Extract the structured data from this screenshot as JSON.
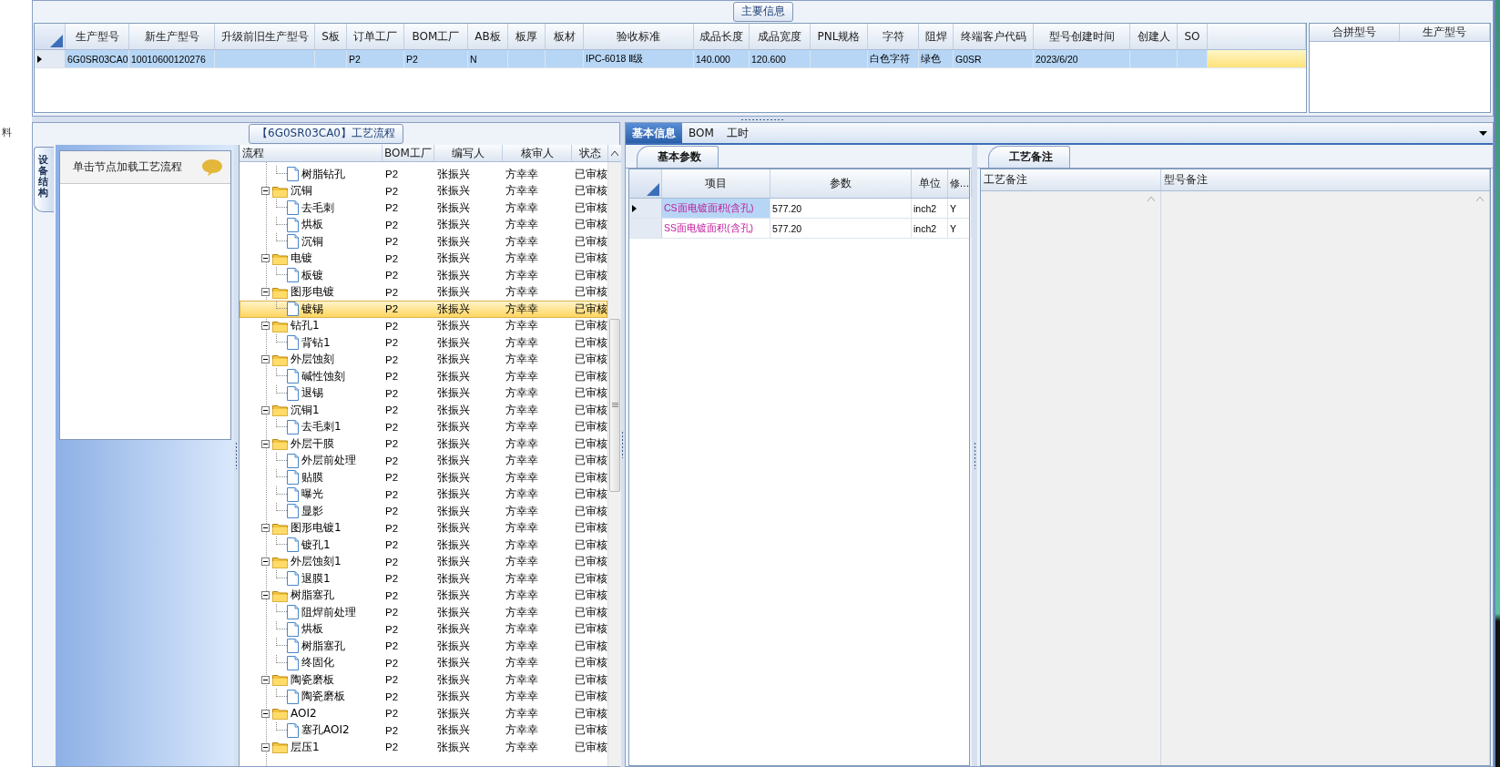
{
  "left_edge_text": "料",
  "main_info": {
    "title": "主要信息",
    "columns": [
      "生产型号",
      "新生产型号",
      "升级前旧生产型号",
      "S板",
      "订单工厂",
      "BOM工厂",
      "AB板",
      "板厚",
      "板材",
      "验收标准",
      "成品长度",
      "成品宽度",
      "PNL规格",
      "字符",
      "阻焊",
      "终端客户代码",
      "型号创建时间",
      "创建人",
      "SO"
    ],
    "rows": [
      {
        "selected": true,
        "cells": [
          "6G0SR03CA0",
          "10010600120276",
          null,
          null,
          "P2",
          "P2",
          "N",
          null,
          null,
          "IPC-6018 Ⅱ级",
          "140.000",
          "120.600",
          null,
          "白色字符",
          "绿色",
          "G0SR",
          "2023/6/20",
          null,
          null
        ]
      }
    ]
  },
  "merge_grid": {
    "columns": [
      "合拼型号",
      "生产型号"
    ]
  },
  "process_panel": {
    "title": "【6G0SR03CA0】工艺流程",
    "side_tabs": [
      {
        "label": "设备结构",
        "selected": true
      }
    ],
    "nav_hint": "单击节点加载工艺流程",
    "tree": {
      "columns": [
        "流程",
        "BOM工厂",
        "编写人",
        "核审人",
        "状态"
      ],
      "items": [
        {
          "kind": "continued",
          "children": [
            {
              "kind": "step",
              "label": "树脂钻孔",
              "bom": "P2",
              "writer": "张振兴",
              "reviewer": "方幸幸",
              "status": "已审核",
              "selected": false
            }
          ]
        },
        {
          "kind": "folder",
          "label": "沉铜",
          "bom": "P2",
          "writer": "张振兴",
          "reviewer": "方幸幸",
          "status": "已审核",
          "selected": false,
          "expanded": true,
          "children": [
            {
              "kind": "step",
              "label": "去毛刺",
              "bom": "P2",
              "writer": "张振兴",
              "reviewer": "方幸幸",
              "status": "已审核",
              "selected": false
            },
            {
              "kind": "step",
              "label": "烘板",
              "bom": "P2",
              "writer": "张振兴",
              "reviewer": "方幸幸",
              "status": "已审核",
              "selected": false
            },
            {
              "kind": "step",
              "label": "沉铜",
              "bom": "P2",
              "writer": "张振兴",
              "reviewer": "方幸幸",
              "status": "已审核",
              "selected": false
            }
          ]
        },
        {
          "kind": "folder",
          "label": "电镀",
          "bom": "P2",
          "writer": "张振兴",
          "reviewer": "方幸幸",
          "status": "已审核",
          "selected": false,
          "expanded": true,
          "children": [
            {
              "kind": "step",
              "label": "板镀",
              "bom": "P2",
              "writer": "张振兴",
              "reviewer": "方幸幸",
              "status": "已审核",
              "selected": false
            }
          ]
        },
        {
          "kind": "folder",
          "label": "图形电镀",
          "bom": "P2",
          "writer": "张振兴",
          "reviewer": "方幸幸",
          "status": "已审核",
          "selected": false,
          "expanded": true,
          "children": [
            {
              "kind": "step",
              "label": "镀锡",
              "bom": "P2",
              "writer": "张振兴",
              "reviewer": "方幸幸",
              "status": "已审核",
              "selected": true
            }
          ]
        },
        {
          "kind": "folder",
          "label": "钻孔1",
          "bom": "P2",
          "writer": "张振兴",
          "reviewer": "方幸幸",
          "status": "已审核",
          "selected": false,
          "expanded": true,
          "children": [
            {
              "kind": "step",
              "label": "背钻1",
              "bom": "P2",
              "writer": "张振兴",
              "reviewer": "方幸幸",
              "status": "已审核",
              "selected": false
            }
          ]
        },
        {
          "kind": "folder",
          "label": "外层蚀刻",
          "bom": "P2",
          "writer": "张振兴",
          "reviewer": "方幸幸",
          "status": "已审核",
          "selected": false,
          "expanded": true,
          "children": [
            {
              "kind": "step",
              "label": "碱性蚀刻",
              "bom": "P2",
              "writer": "张振兴",
              "reviewer": "方幸幸",
              "status": "已审核",
              "selected": false
            },
            {
              "kind": "step",
              "label": "退锡",
              "bom": "P2",
              "writer": "张振兴",
              "reviewer": "方幸幸",
              "status": "已审核",
              "selected": false
            }
          ]
        },
        {
          "kind": "folder",
          "label": "沉铜1",
          "bom": "P2",
          "writer": "张振兴",
          "reviewer": "方幸幸",
          "status": "已审核",
          "selected": false,
          "expanded": true,
          "children": [
            {
              "kind": "step",
              "label": "去毛刺1",
              "bom": "P2",
              "writer": "张振兴",
              "reviewer": "方幸幸",
              "status": "已审核",
              "selected": false
            }
          ]
        },
        {
          "kind": "folder",
          "label": "外层干膜",
          "bom": "P2",
          "writer": "张振兴",
          "reviewer": "方幸幸",
          "status": "已审核",
          "selected": false,
          "expanded": true,
          "children": [
            {
              "kind": "step",
              "label": "外层前处理",
              "bom": "P2",
              "writer": "张振兴",
              "reviewer": "方幸幸",
              "status": "已审核",
              "selected": false
            },
            {
              "kind": "step",
              "label": "贴膜",
              "bom": "P2",
              "writer": "张振兴",
              "reviewer": "方幸幸",
              "status": "已审核",
              "selected": false
            },
            {
              "kind": "step",
              "label": "曝光",
              "bom": "P2",
              "writer": "张振兴",
              "reviewer": "方幸幸",
              "status": "已审核",
              "selected": false
            },
            {
              "kind": "step",
              "label": "显影",
              "bom": "P2",
              "writer": "张振兴",
              "reviewer": "方幸幸",
              "status": "已审核",
              "selected": false
            }
          ]
        },
        {
          "kind": "folder",
          "label": "图形电镀1",
          "bom": "P2",
          "writer": "张振兴",
          "reviewer": "方幸幸",
          "status": "已审核",
          "selected": false,
          "expanded": true,
          "children": [
            {
              "kind": "step",
              "label": "镀孔1",
              "bom": "P2",
              "writer": "张振兴",
              "reviewer": "方幸幸",
              "status": "已审核",
              "selected": false
            }
          ]
        },
        {
          "kind": "folder",
          "label": "外层蚀刻1",
          "bom": "P2",
          "writer": "张振兴",
          "reviewer": "方幸幸",
          "status": "已审核",
          "selected": false,
          "expanded": true,
          "children": [
            {
              "kind": "step",
              "label": "退膜1",
              "bom": "P2",
              "writer": "张振兴",
              "reviewer": "方幸幸",
              "status": "已审核",
              "selected": false
            }
          ]
        },
        {
          "kind": "folder",
          "label": "树脂塞孔",
          "bom": "P2",
          "writer": "张振兴",
          "reviewer": "方幸幸",
          "status": "已审核",
          "selected": false,
          "expanded": true,
          "children": [
            {
              "kind": "step",
              "label": "阻焊前处理",
              "bom": "P2",
              "writer": "张振兴",
              "reviewer": "方幸幸",
              "status": "已审核",
              "selected": false
            },
            {
              "kind": "step",
              "label": "烘板",
              "bom": "P2",
              "writer": "张振兴",
              "reviewer": "方幸幸",
              "status": "已审核",
              "selected": false
            },
            {
              "kind": "step",
              "label": "树脂塞孔",
              "bom": "P2",
              "writer": "张振兴",
              "reviewer": "方幸幸",
              "status": "已审核",
              "selected": false
            },
            {
              "kind": "step",
              "label": "终固化",
              "bom": "P2",
              "writer": "张振兴",
              "reviewer": "方幸幸",
              "status": "已审核",
              "selected": false
            }
          ]
        },
        {
          "kind": "folder",
          "label": "陶瓷磨板",
          "bom": "P2",
          "writer": "张振兴",
          "reviewer": "方幸幸",
          "status": "已审核",
          "selected": false,
          "expanded": true,
          "children": [
            {
              "kind": "step",
              "label": "陶瓷磨板",
              "bom": "P2",
              "writer": "张振兴",
              "reviewer": "方幸幸",
              "status": "已审核",
              "selected": false
            }
          ]
        },
        {
          "kind": "folder",
          "label": "AOI2",
          "bom": "P2",
          "writer": "张振兴",
          "reviewer": "方幸幸",
          "status": "已审核",
          "selected": false,
          "expanded": true,
          "children": [
            {
              "kind": "step",
              "label": "塞孔AOI2",
              "bom": "P2",
              "writer": "张振兴",
              "reviewer": "方幸幸",
              "status": "已审核",
              "selected": false
            }
          ]
        },
        {
          "kind": "folder",
          "label": "层压1",
          "bom": "P2",
          "writer": "张振兴",
          "reviewer": "方幸幸",
          "status": "已审核",
          "selected": false,
          "expanded": true
        }
      ]
    }
  },
  "detail_tabs": [
    {
      "label": "基本信息",
      "selected": true
    },
    {
      "label": "BOM",
      "selected": false
    },
    {
      "label": "工时",
      "selected": false
    }
  ],
  "basic_params": {
    "title": "基本参数",
    "columns": [
      "项目",
      "参数",
      "单位",
      "修..."
    ],
    "rows": [
      {
        "selected": true,
        "item": "CS面电镀面积(含孔)",
        "value": "577.20",
        "unit": "inch2",
        "modified": "Y"
      },
      {
        "selected": false,
        "item": "SS面电镀面积(含孔)",
        "value": "577.20",
        "unit": "inch2",
        "modified": "Y"
      }
    ]
  },
  "notes": {
    "title": "工艺备注",
    "columns": [
      "工艺备注",
      "型号备注"
    ]
  }
}
